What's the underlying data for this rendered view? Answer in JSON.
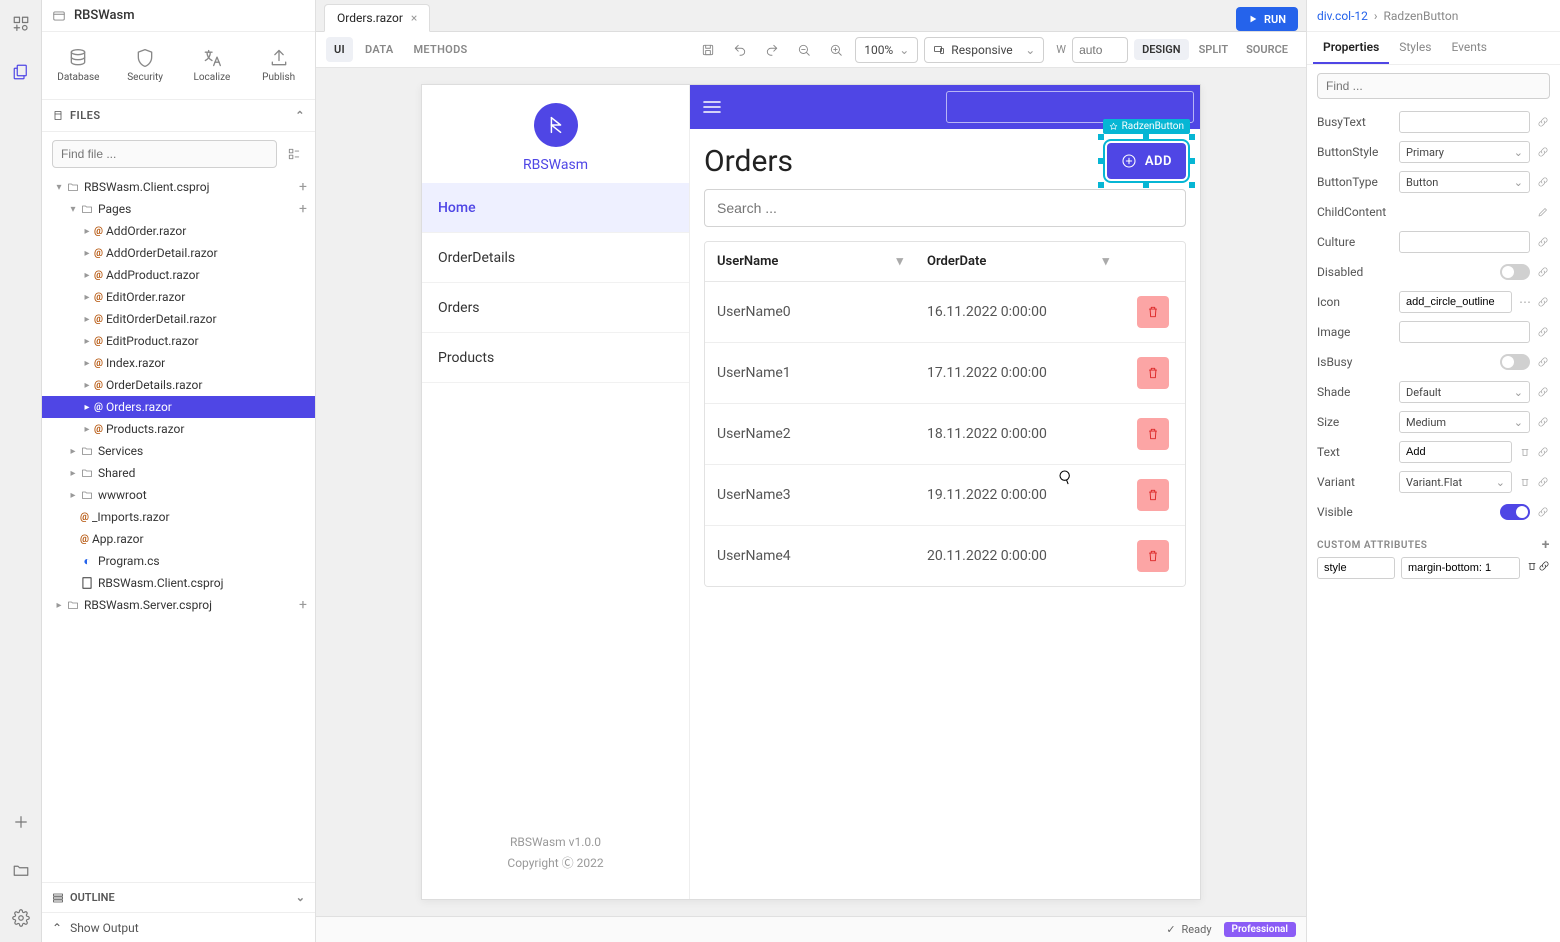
{
  "project_name": "RBSWasm",
  "run_label": "RUN",
  "tools": {
    "database": "Database",
    "security": "Security",
    "localize": "Localize",
    "publish": "Publish"
  },
  "files_label": "FILES",
  "find_file_placeholder": "Find file ...",
  "tree": {
    "client": "RBSWasm.Client.csproj",
    "pages": "Pages",
    "page_items": [
      "AddOrder.razor",
      "AddOrderDetail.razor",
      "AddProduct.razor",
      "EditOrder.razor",
      "EditOrderDetail.razor",
      "EditProduct.razor",
      "Index.razor",
      "OrderDetails.razor",
      "Orders.razor",
      "Products.razor"
    ],
    "selected_page": "Orders.razor",
    "services": "Services",
    "shared": "Shared",
    "wwwroot": "wwwroot",
    "imports": "_Imports.razor",
    "app": "App.razor",
    "program": "Program.cs",
    "clientproj": "RBSWasm.Client.csproj",
    "server": "RBSWasm.Server.csproj"
  },
  "outline_label": "OUTLINE",
  "show_output": "Show Output",
  "tab_title": "Orders.razor",
  "mode_tabs": {
    "ui": "UI",
    "data": "DATA",
    "methods": "METHODS"
  },
  "zoom": "100%",
  "responsive": "Responsive",
  "w_label": "W",
  "w_placeholder": "auto",
  "view_tabs": {
    "design": "DESIGN",
    "split": "SPLIT",
    "source": "SOURCE"
  },
  "preview": {
    "brand": "RBSWasm",
    "nav": [
      "Home",
      "OrderDetails",
      "Orders",
      "Products"
    ],
    "nav_active": "Home",
    "page_title": "Orders",
    "add_label": "ADD",
    "sel_tag": "RadzenButton",
    "search_placeholder": "Search ...",
    "columns": [
      "UserName",
      "OrderDate"
    ],
    "rows": [
      {
        "user": "UserName0",
        "date": "16.11.2022 0:00:00"
      },
      {
        "user": "UserName1",
        "date": "17.11.2022 0:00:00"
      },
      {
        "user": "UserName2",
        "date": "18.11.2022 0:00:00"
      },
      {
        "user": "UserName3",
        "date": "19.11.2022 0:00:00"
      },
      {
        "user": "UserName4",
        "date": "20.11.2022 0:00:00"
      }
    ],
    "footer1": "RBSWasm v1.0.0",
    "footer2": "Copyright Ⓒ 2022"
  },
  "breadcrumb": {
    "parent": "div.col-12",
    "sel": "RadzenButton"
  },
  "prop_tabs": {
    "properties": "Properties",
    "styles": "Styles",
    "events": "Events"
  },
  "prop_find_placeholder": "Find ...",
  "props": {
    "BusyText": "",
    "ButtonStyle": "Primary",
    "ButtonType": "Button",
    "ChildContent": "",
    "Culture": "",
    "Disabled": false,
    "Icon": "add_circle_outline",
    "Image": "",
    "IsBusy": false,
    "Shade": "Default",
    "Size": "Medium",
    "Text": "Add",
    "Variant": "Variant.Flat",
    "Visible": true
  },
  "custom_attr_label": "CUSTOM ATTRIBUTES",
  "custom_attr": {
    "key": "style",
    "value": "margin-bottom: 1"
  },
  "status": {
    "ready": "Ready",
    "plan": "Professional"
  }
}
